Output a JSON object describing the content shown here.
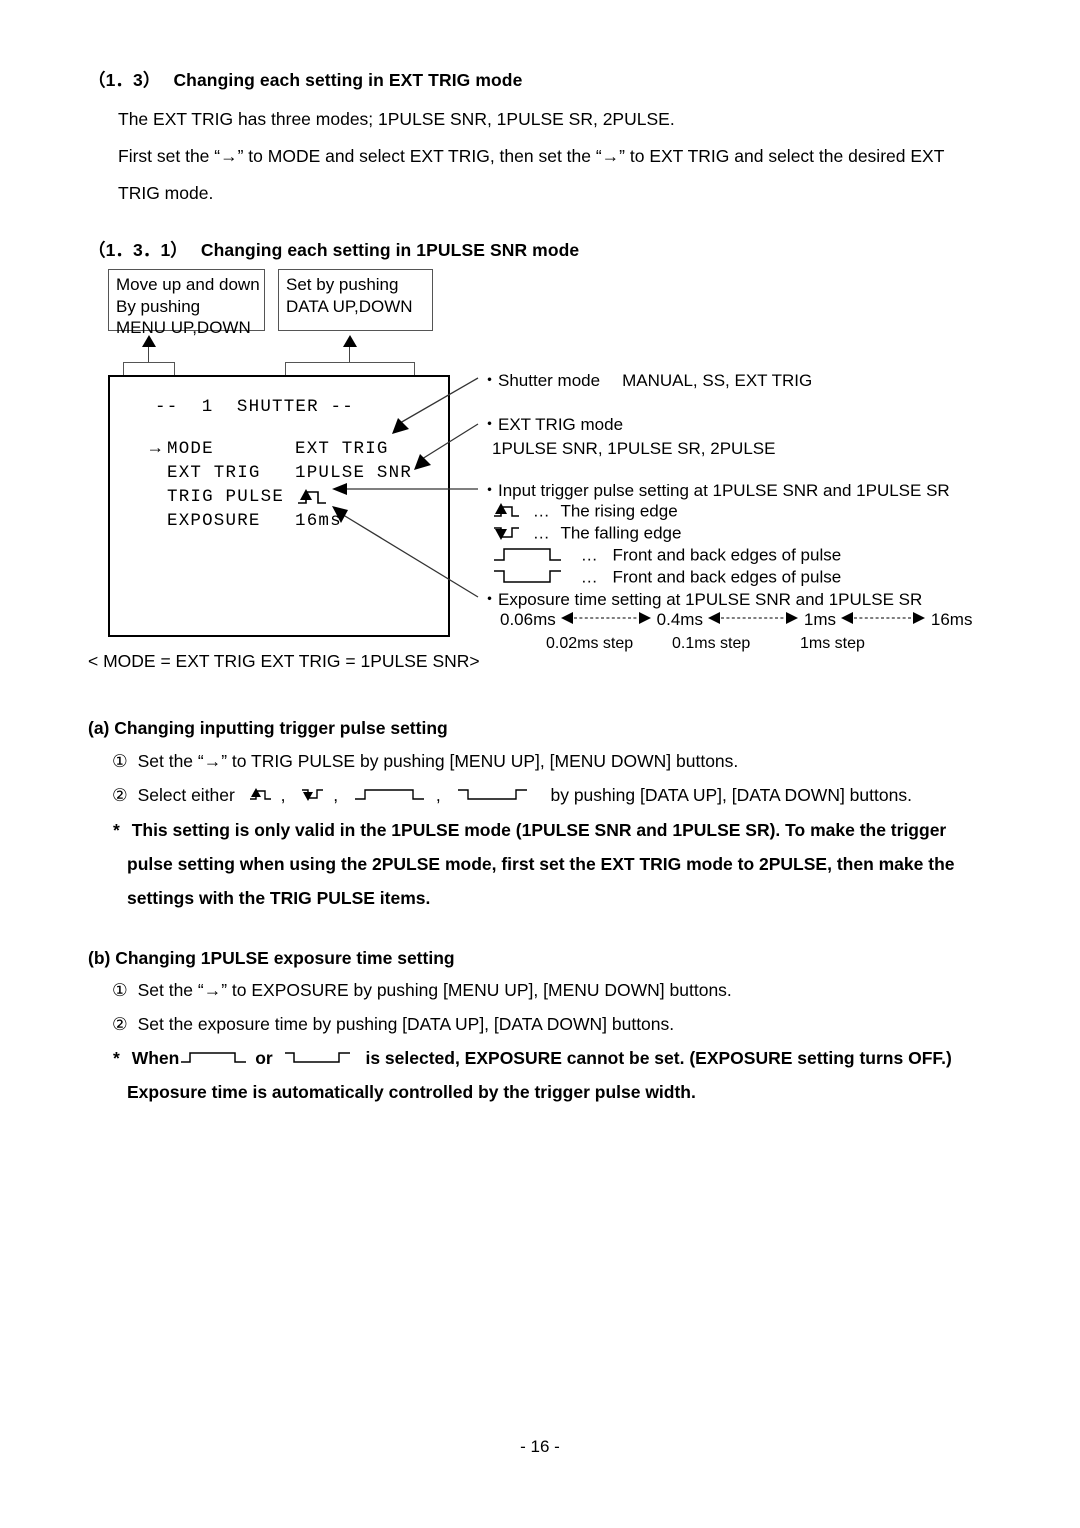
{
  "section": {
    "number": "（1．3）",
    "title": "Changing each setting in EXT TRIG mode",
    "line1": "The EXT TRIG has three modes; 1PULSE SNR, 1PULSE SR, 2PULSE.",
    "line2": "First set the “→” to MODE and select EXT TRIG, then set the “→” to EXT TRIG and select the desired EXT",
    "line3": "TRIG mode."
  },
  "subsection": {
    "number": "（1．3．1）",
    "title": "Changing each setting in 1PULSE SNR mode"
  },
  "callouts": {
    "left": {
      "line1": "Move up and down",
      "line2": "By pushing",
      "line3": "MENU UP,DOWN"
    },
    "right": {
      "line1": "Set by pushing",
      "line2": "DATA UP,DOWN"
    }
  },
  "osd": {
    "title": "--  1  SHUTTER --",
    "rows": [
      {
        "cursor": "→",
        "label": "MODE",
        "value": "EXT TRIG"
      },
      {
        "cursor": "",
        "label": "EXT TRIG",
        "value": "1PULSE SNR"
      },
      {
        "cursor": "",
        "label": "TRIG PULSE",
        "value": ""
      },
      {
        "cursor": "",
        "label": "EXPOSURE",
        "value": "16ms"
      }
    ],
    "caption": "< MODE = EXT TRIG    EXT TRIG = 1PULSE SNR>"
  },
  "annotations": {
    "shutter_mode": {
      "bullet": "・",
      "label": "Shutter mode",
      "values": "MANUAL, SS, EXT TRIG"
    },
    "ext_trig_mode": {
      "bullet": "・",
      "label": "EXT TRIG mode",
      "values": "1PULSE SNR, 1PULSE SR, 2PULSE"
    },
    "trigger_pulse": {
      "bullet": "・",
      "label": "Input trigger pulse setting at 1PULSE SNR and 1PULSE SR",
      "items": [
        {
          "icon": "rising-edge-icon",
          "dots": "…",
          "text": "The rising edge"
        },
        {
          "icon": "falling-edge-icon",
          "dots": "…",
          "text": "The falling edge"
        },
        {
          "icon": "positive-pulse-icon",
          "dots": "…",
          "text": "Front and back edges of pulse"
        },
        {
          "icon": "negative-pulse-icon",
          "dots": "…",
          "text": "Front and back edges of pulse"
        }
      ]
    },
    "exposure": {
      "bullet": "・",
      "label": "Exposure time setting at 1PULSE SNR and 1PULSE SR",
      "scale_points": [
        "0.06ms",
        "0.4ms",
        "1ms",
        "16ms"
      ],
      "scale_steps": [
        "0.02ms step",
        "0.1ms step",
        "1ms step"
      ]
    }
  },
  "part_a": {
    "heading": "(a) Changing inputting trigger pulse setting",
    "step1": {
      "marker": "①",
      "text": "Set the “→” to TRIG PULSE by pushing [MENU UP], [MENU DOWN] buttons."
    },
    "step2": {
      "marker": "②",
      "prefix": "Select either",
      "suffix": "by pushing [DATA UP], [DATA DOWN] buttons."
    },
    "note": {
      "marker": "*",
      "line1": "This setting is only valid in the 1PULSE mode (1PULSE SNR and 1PULSE SR). To make the trigger",
      "line2": "pulse setting when using the 2PULSE mode, first set the EXT TRIG mode to 2PULSE, then make the",
      "line3": "settings with the TRIG PULSE items."
    }
  },
  "part_b": {
    "heading": "(b) Changing 1PULSE exposure time setting",
    "step1": {
      "marker": "①",
      "text": "Set the “→” to EXPOSURE by pushing [MENU UP], [MENU DOWN] buttons."
    },
    "step2": {
      "marker": "②",
      "text": "Set the exposure time by pushing [DATA UP], [DATA DOWN] buttons."
    },
    "note": {
      "marker": "*",
      "when": "When",
      "or": "or",
      "line1_tail": "is selected, EXPOSURE cannot be set. (EXPOSURE setting turns OFF.)",
      "line2": "Exposure time is automatically controlled by the trigger pulse width."
    }
  },
  "footer": {
    "page": "- 16 -"
  }
}
